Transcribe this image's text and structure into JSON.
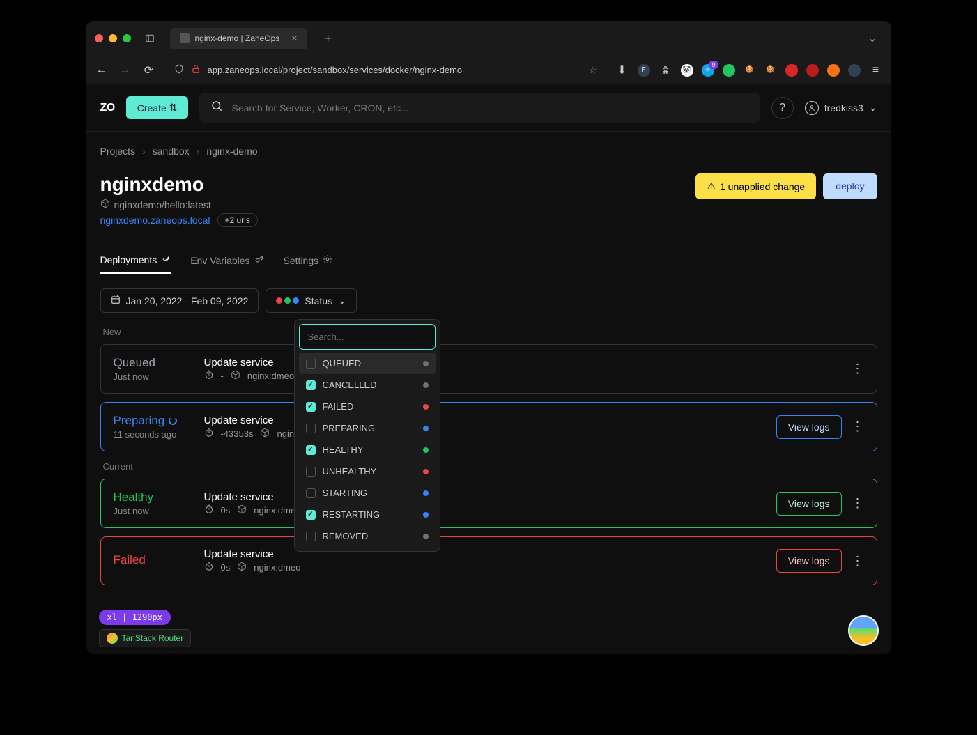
{
  "browser": {
    "tab_title": "nginx-demo | ZaneOps",
    "url": "app.zaneops.local/project/sandbox/services/docker/nginx-demo"
  },
  "topbar": {
    "create_label": "Create",
    "search_placeholder": "Search for Service, Worker, CRON, etc...",
    "username": "fredkiss3"
  },
  "breadcrumb": [
    "Projects",
    "sandbox",
    "nginx-demo"
  ],
  "page": {
    "title": "nginxdemo",
    "image": "nginxdemo/hello:latest",
    "primary_url": "nginxdemo.zaneops.local",
    "extra_urls_badge": "+2 urls",
    "unapplied_label": "1 unapplied change",
    "deploy_label": "deploy"
  },
  "tabs": [
    {
      "label": "Deployments",
      "active": true
    },
    {
      "label": "Env Variables",
      "active": false
    },
    {
      "label": "Settings",
      "active": false
    }
  ],
  "filters": {
    "date_range": "Jan 20, 2022 - Feb 09, 2022",
    "status_label": "Status",
    "search_placeholder": "Search...",
    "options": [
      {
        "label": "QUEUED",
        "checked": false,
        "color": "#6b7280",
        "highlighted": true
      },
      {
        "label": "CANCELLED",
        "checked": true,
        "color": "#6b7280"
      },
      {
        "label": "FAILED",
        "checked": true,
        "color": "#ef4444"
      },
      {
        "label": "PREPARING",
        "checked": false,
        "color": "#3b82f6"
      },
      {
        "label": "HEALTHY",
        "checked": true,
        "color": "#22c55e"
      },
      {
        "label": "UNHEALTHY",
        "checked": false,
        "color": "#ef4444"
      },
      {
        "label": "STARTING",
        "checked": false,
        "color": "#3b82f6"
      },
      {
        "label": "RESTARTING",
        "checked": true,
        "color": "#3b82f6"
      },
      {
        "label": "REMOVED",
        "checked": false,
        "color": "#6b7280"
      }
    ]
  },
  "sections": {
    "new_label": "New",
    "current_label": "Current"
  },
  "deployments": [
    {
      "status": "Queued",
      "status_color": "#9ca3af",
      "time": "Just now",
      "message": "Update service",
      "duration": "-",
      "image": "nginx:dmeo",
      "section": "new",
      "view_logs": false
    },
    {
      "status": "Preparing",
      "status_color": "#3b82f6",
      "time": "11 seconds ago",
      "message": "Update service",
      "duration": "-43353s",
      "image": "ngin",
      "section": "new",
      "view_logs": true,
      "logs_class": "blue",
      "border": "preparing",
      "spinner": true
    },
    {
      "status": "Healthy",
      "status_color": "#22c55e",
      "time": "Just now",
      "message": "Update service",
      "duration": "0s",
      "image": "nginx:dme",
      "section": "current",
      "view_logs": true,
      "logs_class": "green",
      "border": "healthy"
    },
    {
      "status": "Failed",
      "status_color": "#ef4444",
      "time": "",
      "message": "Update service",
      "duration": "0s",
      "image": "nginx:dmeo",
      "section": "current",
      "view_logs": true,
      "logs_class": "red",
      "border": "failed"
    }
  ],
  "labels": {
    "view_logs": "View logs"
  },
  "bottom": {
    "viewport": "xl | 1290px",
    "router": "TanStack Router"
  },
  "ext_badge": "9"
}
